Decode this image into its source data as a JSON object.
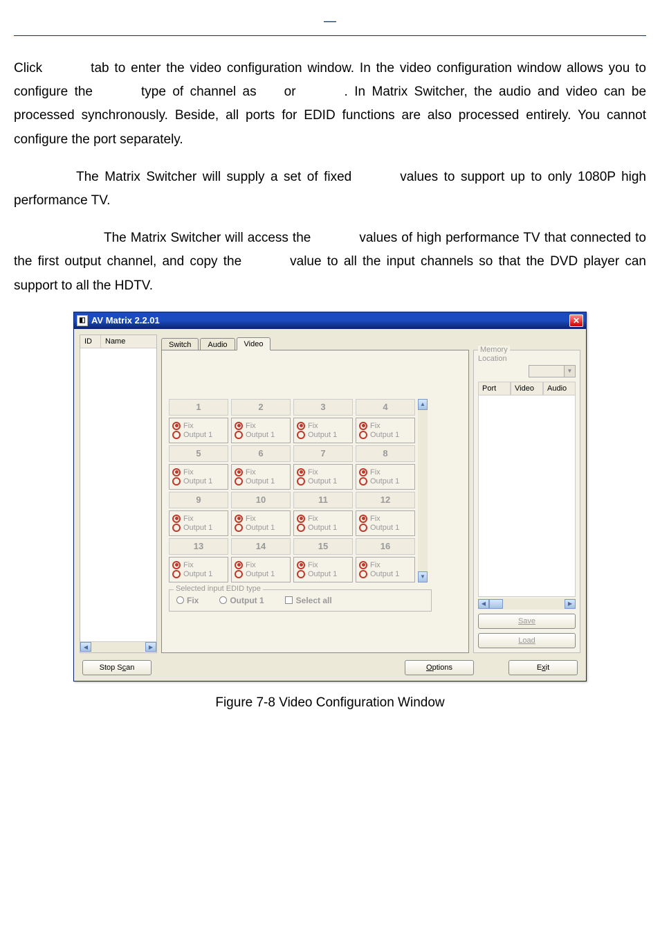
{
  "header_dash": "—",
  "para1_a": "Click",
  "para1_b": "tab to enter the video configuration window. In the video configuration window allows you to configure the",
  "para1_c": "type of channel as",
  "para1_d": "or",
  "para1_e": ". In Matrix Switcher, the audio and video can be processed synchronously. Beside, all ports for EDID functions are also processed entirely. You cannot configure the port separately.",
  "para2_a": "The Matrix Switcher will supply a set of fixed",
  "para2_b": "values to support up to only 1080P high performance TV.",
  "para3_a": "The Matrix Switcher will access the",
  "para3_b": "values of high performance TV that connected to the first output channel, and copy the",
  "para3_c": "value to all the input channels so that the DVD player can support to all the HDTV.",
  "window_title": "AV Matrix 2.2.01",
  "left_col_id": "ID",
  "left_col_name": "Name",
  "tabs": {
    "switch": "Switch",
    "audio": "Audio",
    "video": "Video"
  },
  "channels": [
    "1",
    "2",
    "3",
    "4",
    "5",
    "6",
    "7",
    "8",
    "9",
    "10",
    "11",
    "12",
    "13",
    "14",
    "15",
    "16"
  ],
  "radio_fix": "Fix",
  "radio_output": "Output 1",
  "edid_legend": "Selected input EDID type",
  "edid_fix": "Fix",
  "edid_output": "Output 1",
  "edid_selectall": "Select all",
  "memory_legend": "Memory",
  "memory_location": "Location",
  "mem_col_port": "Port",
  "mem_col_video": "Video",
  "mem_col_audio": "Audio",
  "btn_save": "Save",
  "btn_load": "Load",
  "btn_stopscan_pre": "Stop S",
  "btn_stopscan_u": "c",
  "btn_stopscan_post": "an",
  "btn_options_u": "O",
  "btn_options_post": "ptions",
  "btn_exit_pre": "E",
  "btn_exit_u": "x",
  "btn_exit_post": "it",
  "figure_caption": "Figure 7-8 Video Configuration Window"
}
